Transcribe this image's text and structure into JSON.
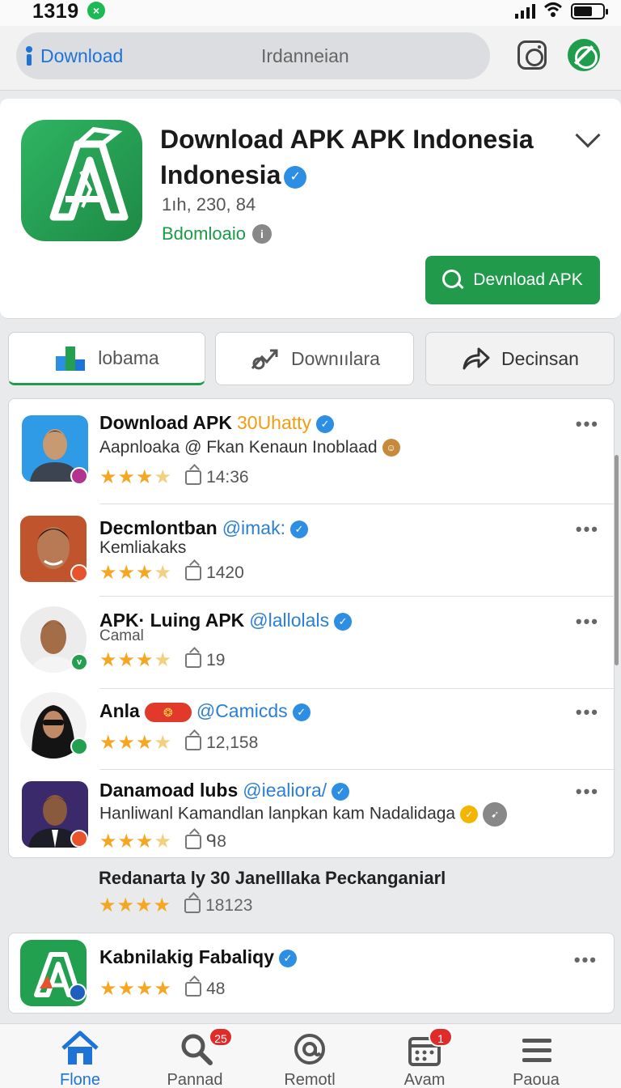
{
  "status_bar": {
    "time": "1319",
    "notif": "×"
  },
  "search": {
    "label": "Download",
    "value": "Irdanneian"
  },
  "app": {
    "title_line1": "Download APK APK Indonesia",
    "title_line2": "Indonesia",
    "verified": "✓",
    "count": "1ıh, 230, 84",
    "subtitle": "Bdomloaio",
    "info": "i",
    "download_label": "Devnload APK",
    "brand_color": "#219a4b"
  },
  "tabs": [
    {
      "label": "lobama"
    },
    {
      "label": "Downıılara"
    },
    {
      "label": "Decinsan"
    }
  ],
  "list": [
    {
      "name": "Download APK",
      "handle": "30Uhatty",
      "sub": "Aapnloaka  @ Fkan Kenaun Inoblaad",
      "time": "14:36",
      "stars": "★★★",
      "star_dim": "★"
    },
    {
      "name": "Decmlontban",
      "handle": "@imak:",
      "sub": "Kemliakaks",
      "time": "1420",
      "stars": "★★★",
      "star_dim": "★"
    },
    {
      "name": "APK· Luing APK",
      "handle": "@lallolals",
      "sub": "Camal",
      "time": "19",
      "stars": "★★★",
      "star_dim": "★"
    },
    {
      "name": "Anla",
      "handle": "@Camicds",
      "sub": "",
      "time": "12,158",
      "stars": "★★★",
      "star_dim": "★"
    },
    {
      "name": "Danamoad lubs",
      "handle": "@iealiora/",
      "sub": "Hanliwanl Kamandlan lanpkan kam Nadalidaga",
      "time": "ᑫ8",
      "stars": "★★★",
      "star_dim": "★"
    }
  ],
  "extra_row": {
    "title": "Redanarta  ly 30 Janelllaka Peckanganiarl",
    "stars": "★★★★",
    "time": "18123"
  },
  "bottom_row": {
    "name": "Kabnilakig Fabaliqy",
    "stars": "★★★★",
    "time": "48"
  },
  "more": "•••",
  "nav": [
    {
      "label": "Flone"
    },
    {
      "label": "Pannad",
      "badge": "25"
    },
    {
      "label": "Remotl"
    },
    {
      "label": "Avam",
      "badge": "1"
    },
    {
      "label": "Paoua"
    }
  ]
}
